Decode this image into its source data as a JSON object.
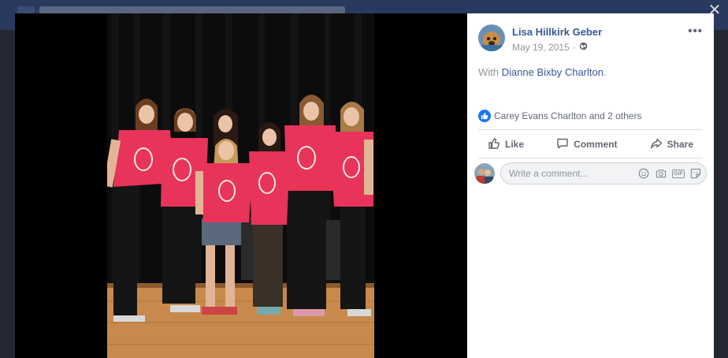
{
  "post": {
    "author": "Lisa Hillkirk Geber",
    "date": "May 19, 2015",
    "date_separator": "·",
    "privacy_icon": "globe-icon",
    "more_label": "•••",
    "with_prefix": "With",
    "with_person": "Dianne Bixby Charlton",
    "with_suffix": "."
  },
  "reactions": {
    "icon": "like-icon",
    "text": "Carey Evans Charlton and 2 others"
  },
  "actions": {
    "like": "Like",
    "comment": "Comment",
    "share": "Share"
  },
  "comment_input": {
    "placeholder": "Write a comment..."
  },
  "comment_icons": [
    "emoji-icon",
    "camera-icon",
    "gif-icon",
    "sticker-icon"
  ],
  "close_label": "✕",
  "colors": {
    "link": "#385898",
    "meta": "#90949c",
    "like_blue": "#1877f2",
    "shirt_red": "#e8345a"
  }
}
